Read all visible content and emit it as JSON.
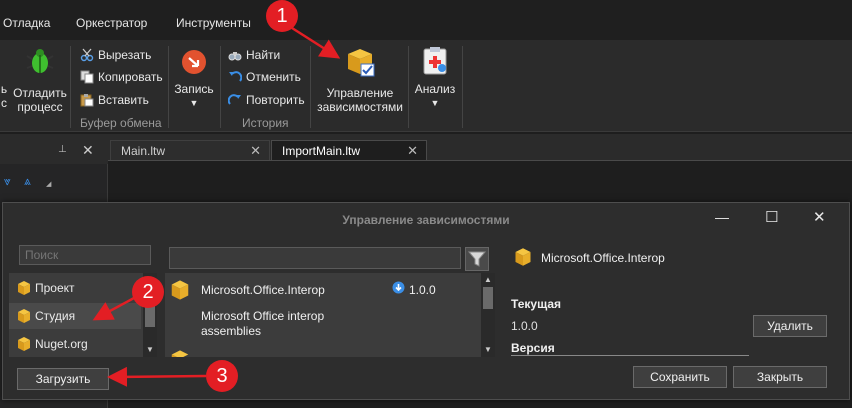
{
  "menu": {
    "items": [
      "Отладка",
      "Оркестратор",
      "Инструменты"
    ]
  },
  "ribbon": {
    "debug_button_partial": "ь\nс",
    "debug_process": "Отладить\nпроцесс",
    "clipboard": {
      "cut": "Вырезать",
      "copy": "Копировать",
      "paste": "Вставить",
      "group_label": "Буфер обмена"
    },
    "record": "Запись",
    "history": {
      "find": "Найти",
      "undo": "Отменить",
      "redo": "Повторить",
      "group_label": "История"
    },
    "manage_dependencies": "Управление\nзависимостями",
    "analyze": "Анализ"
  },
  "tabs": [
    {
      "label": "Main.ltw"
    },
    {
      "label": "ImportMain.ltw"
    }
  ],
  "dialog": {
    "title": "Управление зависимостями",
    "search_placeholder": "Поиск",
    "sources": [
      {
        "label": "Проект"
      },
      {
        "label": "Студия"
      },
      {
        "label": "Nuget.org"
      }
    ],
    "packages": [
      {
        "name": "Microsoft.Office.Interop",
        "version": "1.0.0",
        "description": "Microsoft Office interop\nassemblies"
      }
    ],
    "details": {
      "name": "Microsoft.Office.Interop",
      "current_label": "Текущая",
      "current_value": "1.0.0",
      "version_label": "Версия"
    },
    "buttons": {
      "remove": "Удалить",
      "load": "Загрузить",
      "save": "Сохранить",
      "close": "Закрыть"
    }
  },
  "annotations": {
    "callout1": "1",
    "callout2": "2",
    "callout3": "3"
  },
  "colors": {
    "callout": "#e31e24",
    "accent_blue": "#3a8ee6"
  }
}
